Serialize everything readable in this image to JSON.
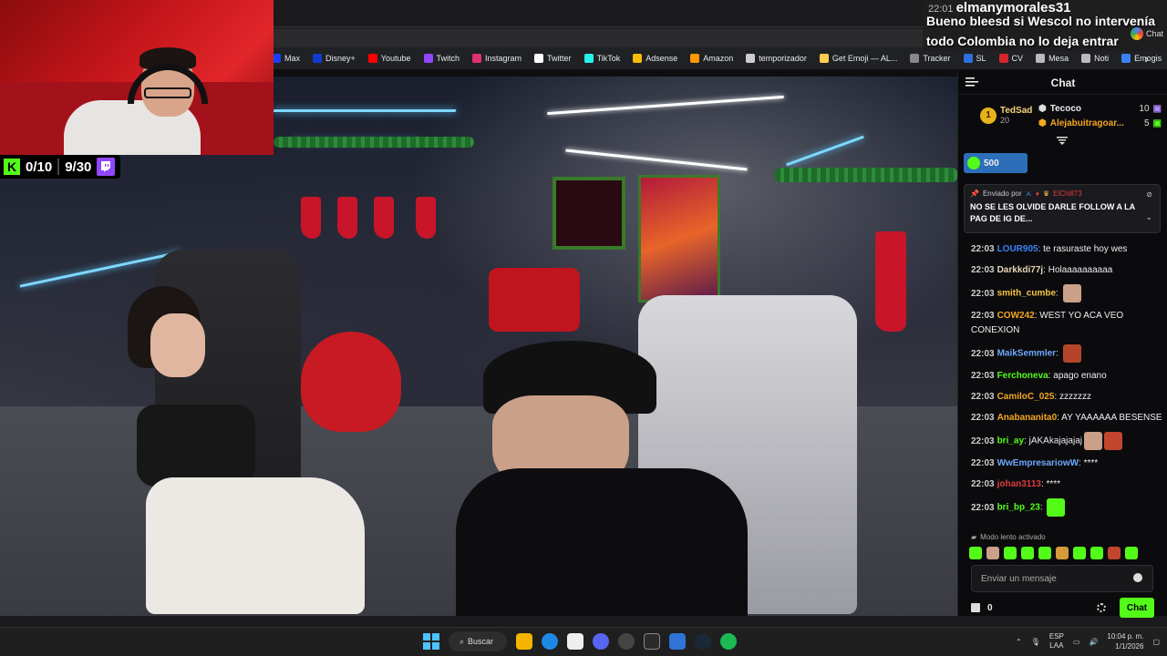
{
  "bookmarks": [
    {
      "label": "Max",
      "color": "#1a3fff",
      "icon": "max-icon"
    },
    {
      "label": "Disney+",
      "color": "#113ccf",
      "icon": "disney-icon"
    },
    {
      "label": "Youtube",
      "color": "#ff0000",
      "icon": "youtube-icon"
    },
    {
      "label": "Twitch",
      "color": "#9146ff",
      "icon": "twitch-icon"
    },
    {
      "label": "Instagram",
      "color": "#e1306c",
      "icon": "instagram-icon"
    },
    {
      "label": "Twitter",
      "color": "#ffffff",
      "icon": "x-icon"
    },
    {
      "label": "TikTok",
      "color": "#25f4ee",
      "icon": "tiktok-icon"
    },
    {
      "label": "Adsense",
      "color": "#fbbc05",
      "icon": "adsense-icon"
    },
    {
      "label": "Amazon",
      "color": "#ff9900",
      "icon": "amazon-icon"
    },
    {
      "label": "temporizador",
      "color": "#cccccc",
      "icon": "timer-icon"
    },
    {
      "label": "Get Emoji — AL...",
      "color": "#ffcc4d",
      "icon": "emoji-icon"
    },
    {
      "label": "Tracker",
      "color": "#888888",
      "icon": "tracker-icon"
    },
    {
      "label": "SL",
      "color": "#2f6fdf",
      "icon": "sl-icon"
    },
    {
      "label": "CV",
      "color": "#d6262d",
      "icon": "cv-icon"
    },
    {
      "label": "Mesa",
      "color": "#bbbbbb",
      "icon": "k-icon"
    },
    {
      "label": "Noti",
      "color": "#bbbbbb",
      "icon": "k-icon"
    },
    {
      "label": "Emogis",
      "color": "#3b82f6",
      "icon": "emogis-icon"
    }
  ],
  "stream_stats": {
    "kick_count": "0/10",
    "twitch_count": "9/30"
  },
  "popup": {
    "time": "22:01",
    "user": "elmanymorales31",
    "line1": "Bueno bleesd si Wescol no intervenía",
    "line2": "todo Colombia no lo deja entrar",
    "chat_label": "Chat"
  },
  "chat": {
    "title": "Chat",
    "leaderboard": {
      "first": {
        "rank": "1",
        "name": "TedSad",
        "count": "20"
      },
      "second": {
        "name": "Tecoco",
        "count": "10"
      },
      "third": {
        "name": "Alejabuitragoar...",
        "count": "5"
      }
    },
    "gift_amount": "500",
    "pinned": {
      "sent_by": "Enviado por",
      "user": "ElChill73",
      "text": "NO SE LES OLVIDE DARLE FOLLOW A LA PAG DE IG DE..."
    },
    "messages": [
      {
        "time": "22:03",
        "user": "LOUR905",
        "color": "#3b82f6",
        "text": "te rasuraste hoy wes"
      },
      {
        "time": "22:03",
        "user": "Darkkdi77j",
        "color": "#e6d5b8",
        "text": "Holaaaaaaaaaa"
      },
      {
        "time": "22:03",
        "user": "smith_cumbe",
        "color": "#f5c542",
        "text": ""
      },
      {
        "time": "22:03",
        "user": "COW242",
        "color": "#f5a623",
        "text": "WEST YO ACA VEO CONEXION"
      },
      {
        "time": "22:03",
        "user": "MaikSemmler",
        "color": "#6ea8fe",
        "text": ""
      },
      {
        "time": "22:03",
        "user": "Ferchoneva",
        "color": "#53fc18",
        "text": "apago enano"
      },
      {
        "time": "22:03",
        "user": "CamiloC_025",
        "color": "#f5a623",
        "text": "zzzzzzz"
      },
      {
        "time": "22:03",
        "user": "Anabananita0",
        "color": "#f5a623",
        "text": "AY YAAAAAA BESENSE"
      },
      {
        "time": "22:03",
        "user": "bri_ay",
        "color": "#53fc18",
        "text": "jAKAkajajajaj"
      },
      {
        "time": "22:03",
        "user": "WwEmpresariowW",
        "color": "#6ea8fe",
        "text": "****"
      },
      {
        "time": "22:03",
        "user": "johan3113",
        "color": "#e03b3b",
        "text": "****"
      },
      {
        "time": "22:03",
        "user": "bri_bp_23",
        "color": "#53fc18",
        "text": ""
      }
    ],
    "slow_mode": "Modo lento activado",
    "input_placeholder": "Enviar un mensaje",
    "gift_count": "0",
    "send_label": "Chat"
  },
  "taskbar": {
    "search_label": "Buscar",
    "lang_line1": "ESP",
    "lang_line2": "LAA",
    "time": "10:04 p. m.",
    "date": "1/1/2026"
  }
}
